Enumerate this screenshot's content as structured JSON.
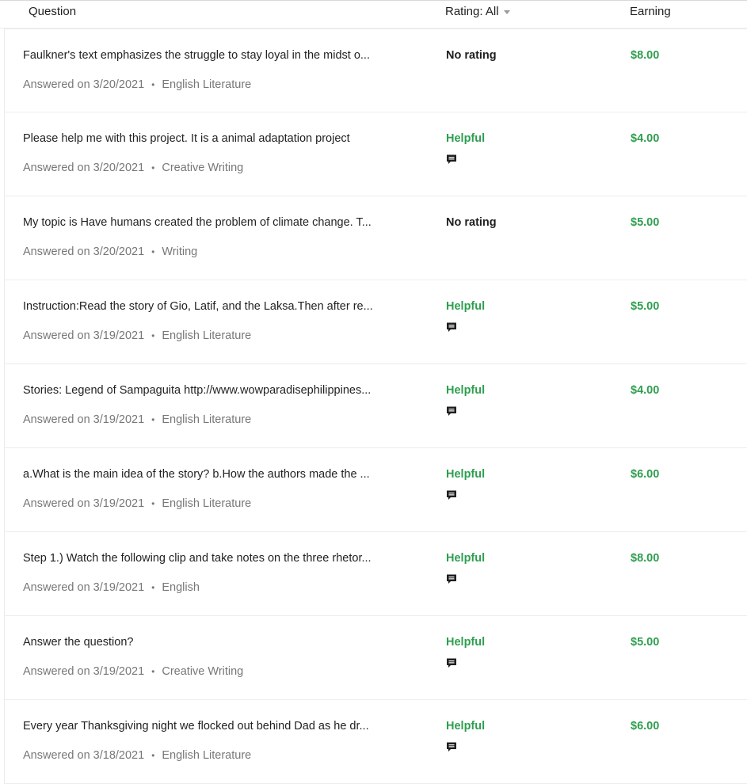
{
  "header": {
    "question": "Question",
    "rating": "Rating: All",
    "earning": "Earning"
  },
  "rows": [
    {
      "question": "Faulkner's text emphasizes the struggle to stay loyal in the midst o...",
      "date": "Answered on 3/20/2021",
      "subject": "English Literature",
      "rating": "No rating",
      "has_comment": false,
      "earning": "$8.00"
    },
    {
      "question": "Please help me with this project. It is a animal adaptation project",
      "date": "Answered on 3/20/2021",
      "subject": "Creative Writing",
      "rating": "Helpful",
      "has_comment": true,
      "earning": "$4.00"
    },
    {
      "question": "My topic is Have humans created the problem of climate change. T...",
      "date": "Answered on 3/20/2021",
      "subject": "Writing",
      "rating": "No rating",
      "has_comment": false,
      "earning": "$5.00"
    },
    {
      "question": "Instruction:Read the story of Gio, Latif, and the Laksa.Then after re...",
      "date": "Answered on 3/19/2021",
      "subject": "English Literature",
      "rating": "Helpful",
      "has_comment": true,
      "earning": "$5.00"
    },
    {
      "question": "Stories: Legend of Sampaguita http://www.wowparadisephilippines...",
      "date": "Answered on 3/19/2021",
      "subject": "English Literature",
      "rating": "Helpful",
      "has_comment": true,
      "earning": "$4.00"
    },
    {
      "question": "a.What is the main idea of the story? b.How the authors made the ...",
      "date": "Answered on 3/19/2021",
      "subject": "English Literature",
      "rating": "Helpful",
      "has_comment": true,
      "earning": "$6.00"
    },
    {
      "question": "Step 1.) Watch the following clip and take notes on the three rhetor...",
      "date": "Answered on 3/19/2021",
      "subject": "English",
      "rating": "Helpful",
      "has_comment": true,
      "earning": "$8.00"
    },
    {
      "question": "Answer the question?",
      "date": "Answered on 3/19/2021",
      "subject": "Creative Writing",
      "rating": "Helpful",
      "has_comment": true,
      "earning": "$5.00"
    },
    {
      "question": "Every year Thanksgiving night we flocked out behind Dad as he dr...",
      "date": "Answered on 3/18/2021",
      "subject": "English Literature",
      "rating": "Helpful",
      "has_comment": true,
      "earning": "$6.00"
    }
  ],
  "icons": {
    "comment": "comment-icon",
    "sort": "caret-down-icon"
  },
  "colors": {
    "helpful": "#2e9e4f",
    "earning": "#2e9e4f",
    "meta_text": "#777777"
  }
}
